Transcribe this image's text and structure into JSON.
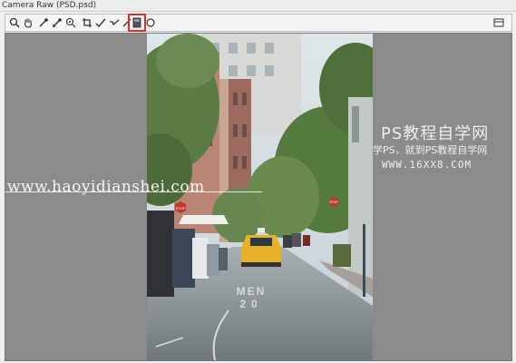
{
  "window": {
    "title": "Camera Raw (PSD.psd)"
  },
  "toolbar": {
    "tools": [
      {
        "name": "zoom-tool-icon",
        "selected": false
      },
      {
        "name": "hand-tool-icon",
        "selected": false
      },
      {
        "name": "white-balance-tool-icon",
        "selected": false
      },
      {
        "name": "color-sampler-tool-icon",
        "selected": false
      },
      {
        "name": "targeted-adjustment-tool-icon",
        "selected": false
      },
      {
        "name": "crop-tool-icon",
        "selected": false
      },
      {
        "name": "straighten-tool-icon",
        "selected": false
      },
      {
        "name": "spot-removal-tool-icon",
        "selected": false
      },
      {
        "name": "red-eye-removal-tool-icon",
        "selected": false
      },
      {
        "name": "adjustment-brush-tool-icon",
        "selected": false
      },
      {
        "name": "graduated-filter-tool-icon",
        "selected": true
      },
      {
        "name": "radial-filter-tool-icon",
        "selected": false
      }
    ],
    "highlight_color": "#e32b2b"
  },
  "watermarks": {
    "left_url": "www.haoyidianshei.com",
    "right_title": "PS教程自学网",
    "right_subtitle": "学PS，就到PS教程自学网",
    "right_url": "WWW.16XX8.COM"
  },
  "photo": {
    "description_sign_1": "STOP",
    "description_sign_2": "STOP",
    "road_text_1": "MEN",
    "road_text_2": "20"
  }
}
